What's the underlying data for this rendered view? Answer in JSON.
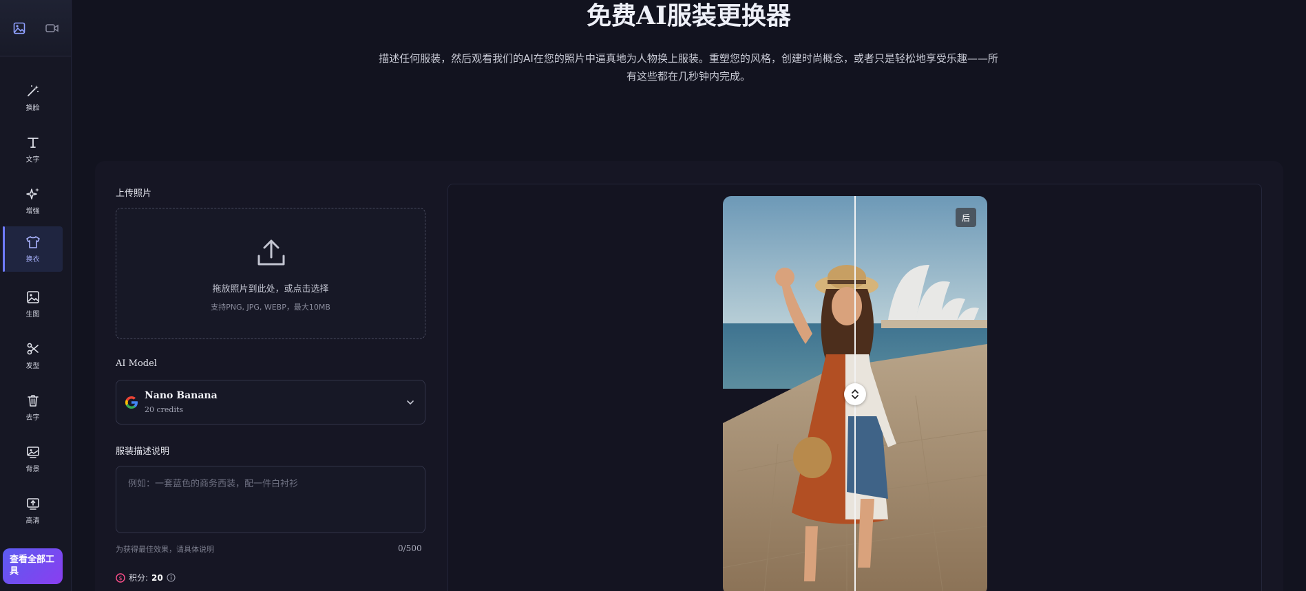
{
  "sidebar": {
    "top_icons": [
      "image-icon",
      "video-icon"
    ],
    "items": [
      {
        "label": "换脸",
        "icon": "magic-wand-icon"
      },
      {
        "label": "文字",
        "icon": "text-icon"
      },
      {
        "label": "增强",
        "icon": "sparkle-icon"
      },
      {
        "label": "换衣",
        "icon": "shirt-icon",
        "active": true
      },
      {
        "label": "生图",
        "icon": "image-icon"
      },
      {
        "label": "发型",
        "icon": "scissors-icon"
      },
      {
        "label": "去字",
        "icon": "trash-icon"
      },
      {
        "label": "背景",
        "icon": "background-icon"
      },
      {
        "label": "高清",
        "icon": "upscale-icon"
      }
    ],
    "cta_label": "查看全部工具"
  },
  "header": {
    "title": "免费AI服装更换器",
    "subtitle": "描述任何服装，然后观看我们的AI在您的照片中逼真地为人物换上服装。重塑您的风格，创建时尚概念，或者只是轻松地享受乐趣——所有这些都在几秒钟内完成。"
  },
  "upload": {
    "label": "上传照片",
    "main_text": "拖放照片到此处，或点击选择",
    "sub_text": "支持PNG, JPG, WEBP，最大10MB"
  },
  "model": {
    "label": "AI Model",
    "name": "Nano Banana",
    "credits": "20 credits"
  },
  "description": {
    "label": "服装描述说明",
    "placeholder": "例如：一套蓝色的商务西装，配一件白衬衫",
    "hint": "为获得最佳效果，请具体说明",
    "count": "0/500"
  },
  "points": {
    "label": "积分:",
    "value": "20"
  },
  "preview": {
    "badge": "后"
  },
  "colors": {
    "accent": "#6f7cff",
    "cta_start": "#5b5cf0",
    "cta_end": "#8a3ef0",
    "background": "#12131f"
  }
}
